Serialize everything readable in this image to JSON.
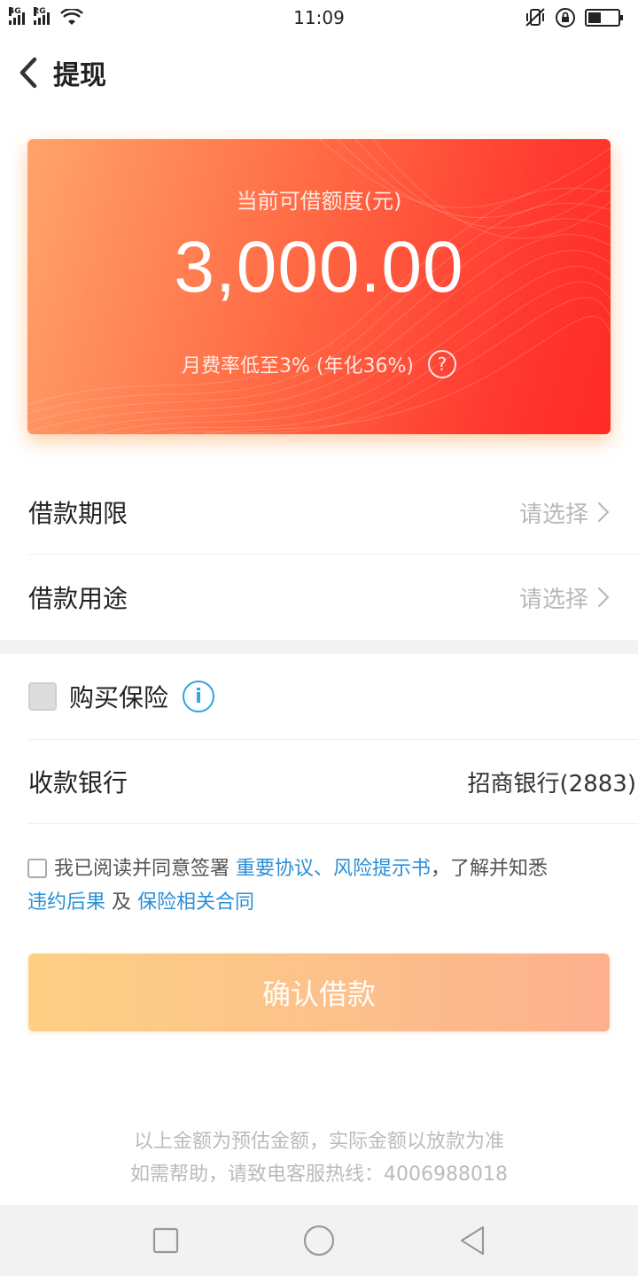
{
  "status_bar": {
    "network_1": "4G",
    "network_2": "2G",
    "time": "11:09",
    "battery_level": 0.45
  },
  "header": {
    "title": "提现"
  },
  "card": {
    "label": "当前可借额度(元)",
    "amount": "3,000.00",
    "rate_text": "月费率低至3% (年化36%)",
    "help_glyph": "?"
  },
  "loan_term": {
    "label": "借款期限",
    "value": "请选择"
  },
  "loan_purpose": {
    "label": "借款用途",
    "value": "请选择"
  },
  "insurance": {
    "label": "购买保险",
    "info_glyph": "i",
    "checked": false
  },
  "bank": {
    "label": "收款银行",
    "value": "招商银行(2883)"
  },
  "agreement": {
    "prefix": "我已阅读并同意签署",
    "link_1": "重要协议、风险提示书",
    "middle": "，了解并知悉",
    "link_2": "违约后果",
    "and": "及",
    "link_3": "保险相关合同"
  },
  "confirm_button": {
    "label": "确认借款"
  },
  "footer": {
    "line_1": "以上金额为预估金额，实际金额以放款为准",
    "line_2": "如需帮助，请致电客服热线：4006988018"
  },
  "colors": {
    "card_start": "#ffa46c",
    "card_end": "#ff2a26",
    "link": "#2b8fd8",
    "info": "#2ea3e0",
    "button_start": "#fdd084",
    "button_end": "#fdb08e"
  }
}
